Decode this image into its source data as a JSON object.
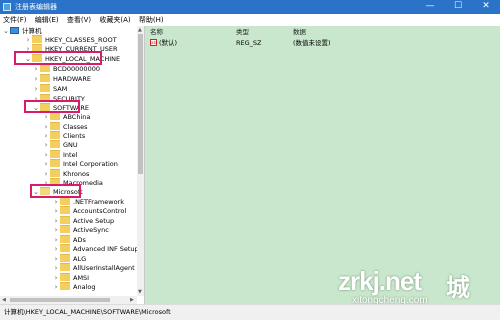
{
  "window": {
    "title": "注册表编辑器"
  },
  "window_buttons": {
    "minimize": "—",
    "maximize": "☐",
    "close": "✕"
  },
  "menu": [
    "文件(F)",
    "编辑(E)",
    "查看(V)",
    "收藏夹(A)",
    "帮助(H)"
  ],
  "tree": {
    "root": "计算机",
    "classes_root": "HKEY_CLASSES_ROOT",
    "current_user": "HKEY_CURRENT_USER",
    "local_machine": "HKEY_LOCAL_MACHINE",
    "lm_children": [
      "BCD00000000",
      "HARDWARE",
      "SAM",
      "SECURITY"
    ],
    "software": "SOFTWARE",
    "sw_children": [
      "ABChina",
      "Classes",
      "Clients",
      "GNU",
      "Intel",
      "Intel Corporation",
      "Khronos",
      "Macromedia"
    ],
    "microsoft": "Microsoft",
    "ms_children": [
      ".NETFramework",
      "AccountsControl",
      "Active Setup",
      "ActiveSync",
      "ADs",
      "Advanced INF Setup",
      "ALG",
      "AllUserInstallAgent",
      "AMSI",
      "Analog"
    ]
  },
  "columns": {
    "name": "名称",
    "type": "类型",
    "data": "数据"
  },
  "values": [
    {
      "name": "(默认)",
      "type": "REG_SZ",
      "data": "(数值未设置)"
    }
  ],
  "status": "计算机\\HKEY_LOCAL_MACHINE\\SOFTWARE\\Microsoft",
  "watermark": {
    "main": "zrkj.net",
    "sub": "xitongcheng.com",
    "cheng": "城"
  },
  "colors": {
    "titlebar": "#2a73c8",
    "value_pane": "#c9e7cd",
    "highlight": "#d81b6b"
  }
}
